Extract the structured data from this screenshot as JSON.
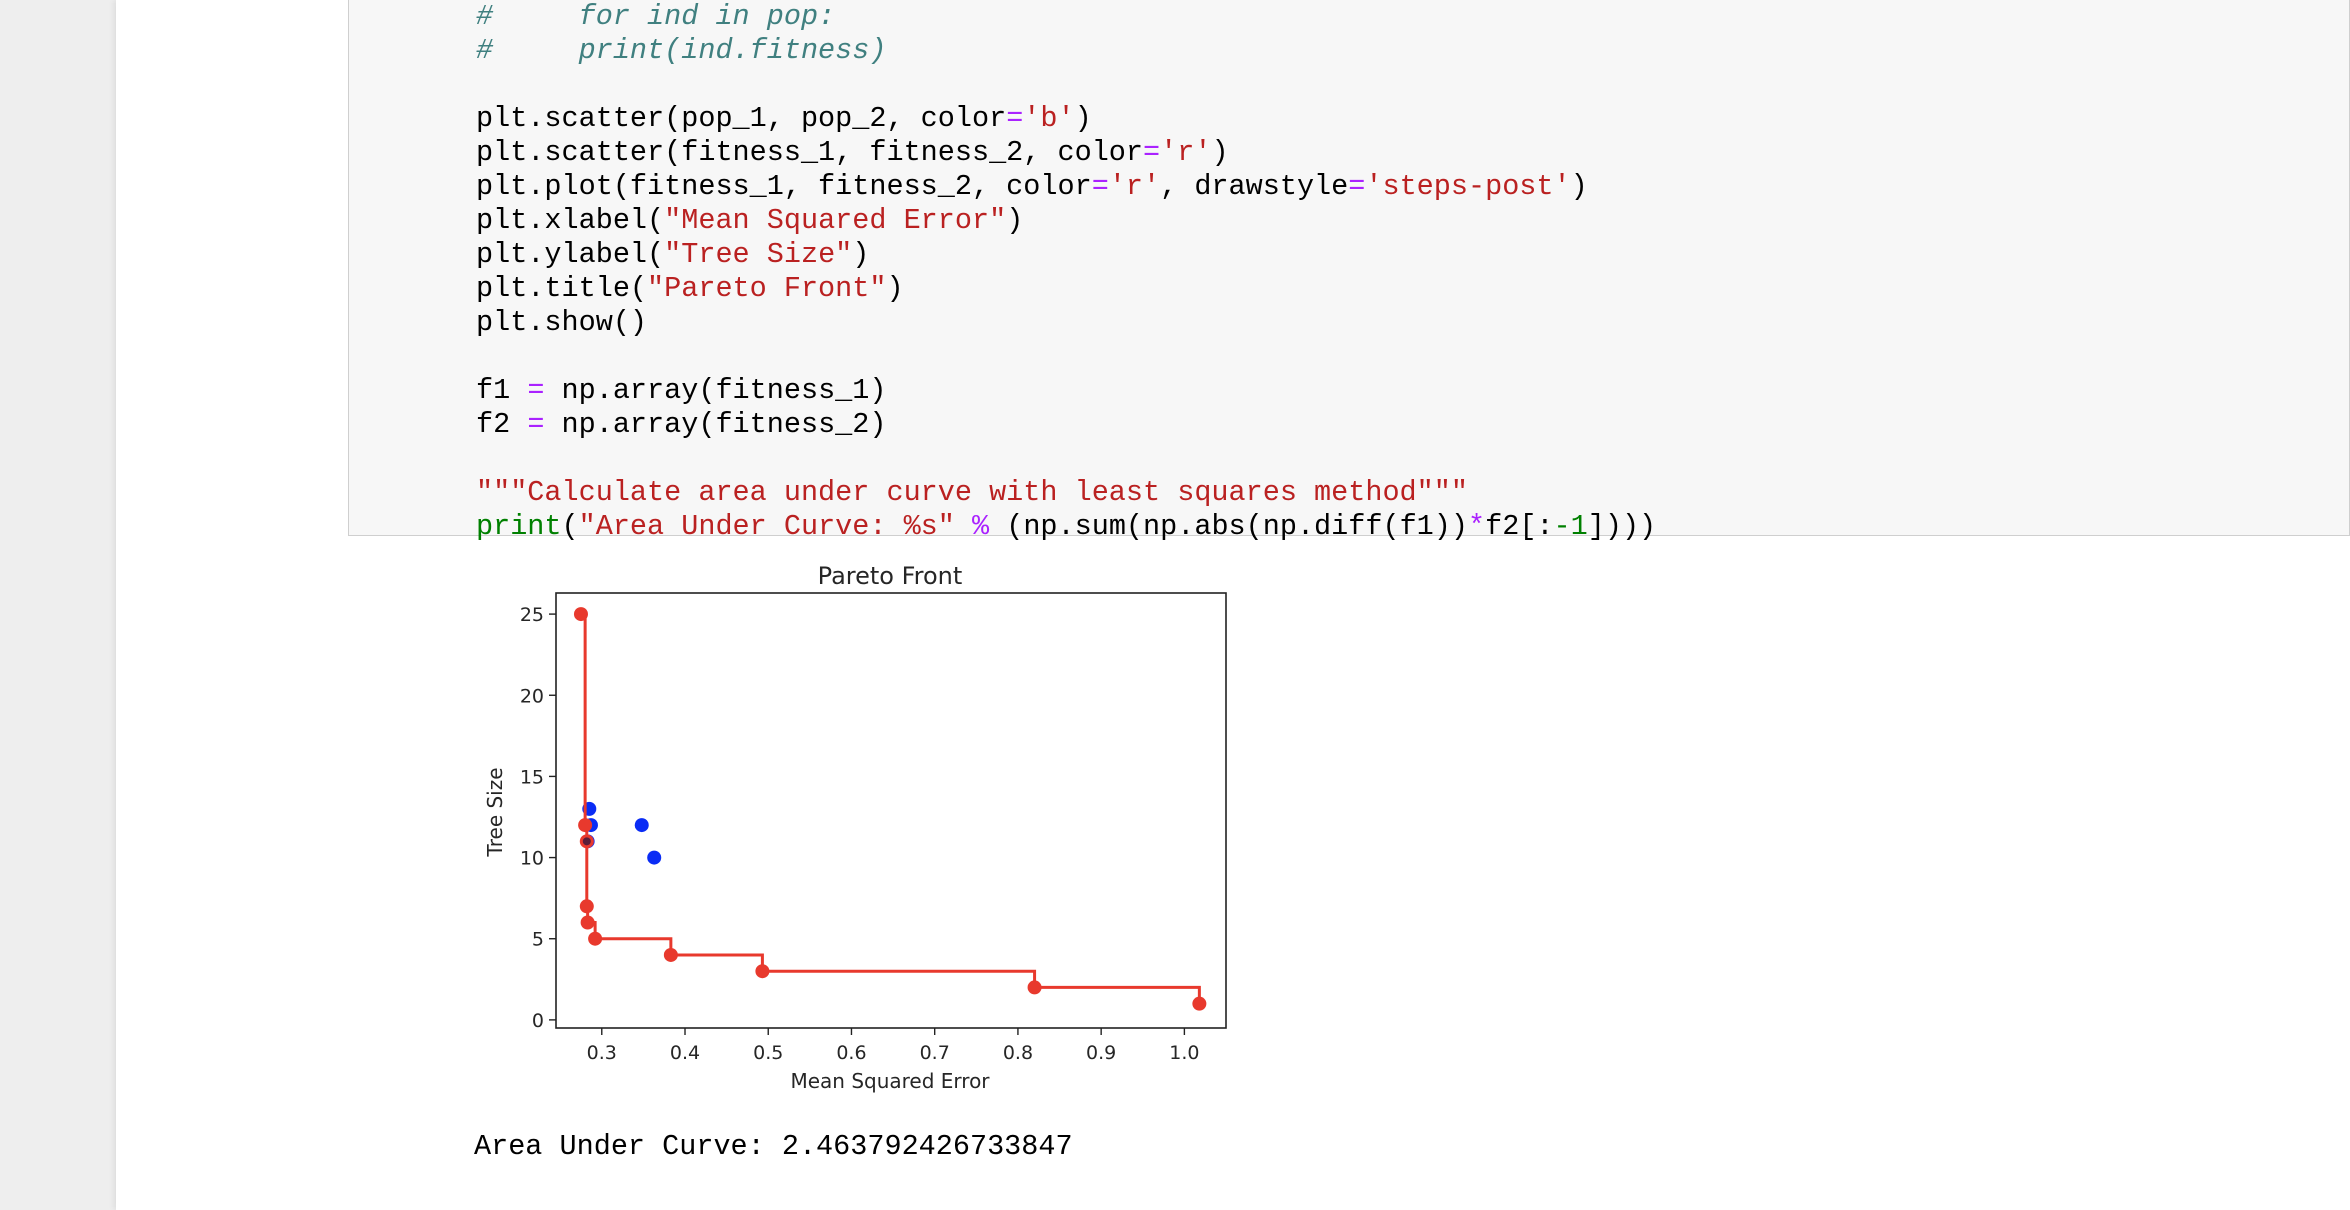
{
  "code_lines": [
    [
      {
        "t": "#     for ind in pop:",
        "c": "cm"
      }
    ],
    [
      {
        "t": "#     print(ind.fitness)",
        "c": "cm"
      }
    ],
    [],
    [
      {
        "t": "plt.scatter(pop_1, pop_2, color"
      },
      {
        "t": "=",
        "c": "op"
      },
      {
        "t": "'b'",
        "c": "st"
      },
      {
        "t": ")"
      }
    ],
    [
      {
        "t": "plt.scatter(fitness_1, fitness_2, color"
      },
      {
        "t": "=",
        "c": "op"
      },
      {
        "t": "'r'",
        "c": "st"
      },
      {
        "t": ")"
      }
    ],
    [
      {
        "t": "plt.plot(fitness_1, fitness_2, color"
      },
      {
        "t": "=",
        "c": "op"
      },
      {
        "t": "'r'",
        "c": "st"
      },
      {
        "t": ", drawstyle"
      },
      {
        "t": "=",
        "c": "op"
      },
      {
        "t": "'steps-post'",
        "c": "st"
      },
      {
        "t": ")"
      }
    ],
    [
      {
        "t": "plt.xlabel("
      },
      {
        "t": "\"Mean Squared Error\"",
        "c": "st"
      },
      {
        "t": ")"
      }
    ],
    [
      {
        "t": "plt.ylabel("
      },
      {
        "t": "\"Tree Size\"",
        "c": "st"
      },
      {
        "t": ")"
      }
    ],
    [
      {
        "t": "plt.title("
      },
      {
        "t": "\"Pareto Front\"",
        "c": "st"
      },
      {
        "t": ")"
      }
    ],
    [
      {
        "t": "plt.show()"
      }
    ],
    [],
    [
      {
        "t": "f1 "
      },
      {
        "t": "=",
        "c": "op"
      },
      {
        "t": " np.array(fitness_1)"
      }
    ],
    [
      {
        "t": "f2 "
      },
      {
        "t": "=",
        "c": "op"
      },
      {
        "t": " np.array(fitness_2)"
      }
    ],
    [],
    [
      {
        "t": "\"\"\"Calculate area under curve with least squares method\"\"\"",
        "c": "st"
      }
    ],
    [
      {
        "t": "print",
        "c": "kw"
      },
      {
        "t": "("
      },
      {
        "t": "\"Area Under Curve: %s\"",
        "c": "st"
      },
      {
        "t": " "
      },
      {
        "t": "%",
        "c": "op"
      },
      {
        "t": " (np.sum(np.abs(np.diff(f1))"
      },
      {
        "t": "*",
        "c": "op"
      },
      {
        "t": "f2[:"
      },
      {
        "t": "-1",
        "c": "nm"
      },
      {
        "t": "])))"
      }
    ]
  ],
  "output": {
    "text": "Area Under Curve: 2.463792426733847"
  },
  "colors": {
    "blue_series": "#0a2cf5",
    "red_series": "#e8392d",
    "string": "#ba2121",
    "comment": "#408080",
    "operator": "#aa22ff"
  },
  "chart_data": {
    "type": "scatter",
    "title": "Pareto Front",
    "xlabel": "Mean Squared Error",
    "ylabel": "Tree Size",
    "xlim": [
      0.245,
      1.05
    ],
    "ylim": [
      -0.5,
      26.3
    ],
    "xticks": [
      0.3,
      0.4,
      0.5,
      0.6,
      0.7,
      0.8,
      0.9,
      1.0
    ],
    "xtick_labels": [
      "0.3",
      "0.4",
      "0.5",
      "0.6",
      "0.7",
      "0.8",
      "0.9",
      "1.0"
    ],
    "yticks": [
      0,
      5,
      10,
      15,
      20,
      25
    ],
    "ytick_labels": [
      "0",
      "5",
      "10",
      "15",
      "20",
      "25"
    ],
    "grid": false,
    "series": [
      {
        "color": "#0a2cf5",
        "points": [
          [
            0.285,
            13
          ],
          [
            0.287,
            12
          ],
          [
            0.283,
            11
          ],
          [
            0.348,
            12
          ],
          [
            0.363,
            10
          ]
        ]
      },
      {
        "color": "#e8392d",
        "drawstyle": "steps-post",
        "points": [
          [
            0.275,
            25
          ],
          [
            0.28,
            12
          ],
          [
            0.282,
            11
          ],
          [
            0.282,
            7
          ],
          [
            0.283,
            6
          ],
          [
            0.292,
            5
          ],
          [
            0.383,
            4
          ],
          [
            0.493,
            3
          ],
          [
            0.82,
            2
          ],
          [
            1.018,
            1
          ]
        ]
      }
    ]
  }
}
